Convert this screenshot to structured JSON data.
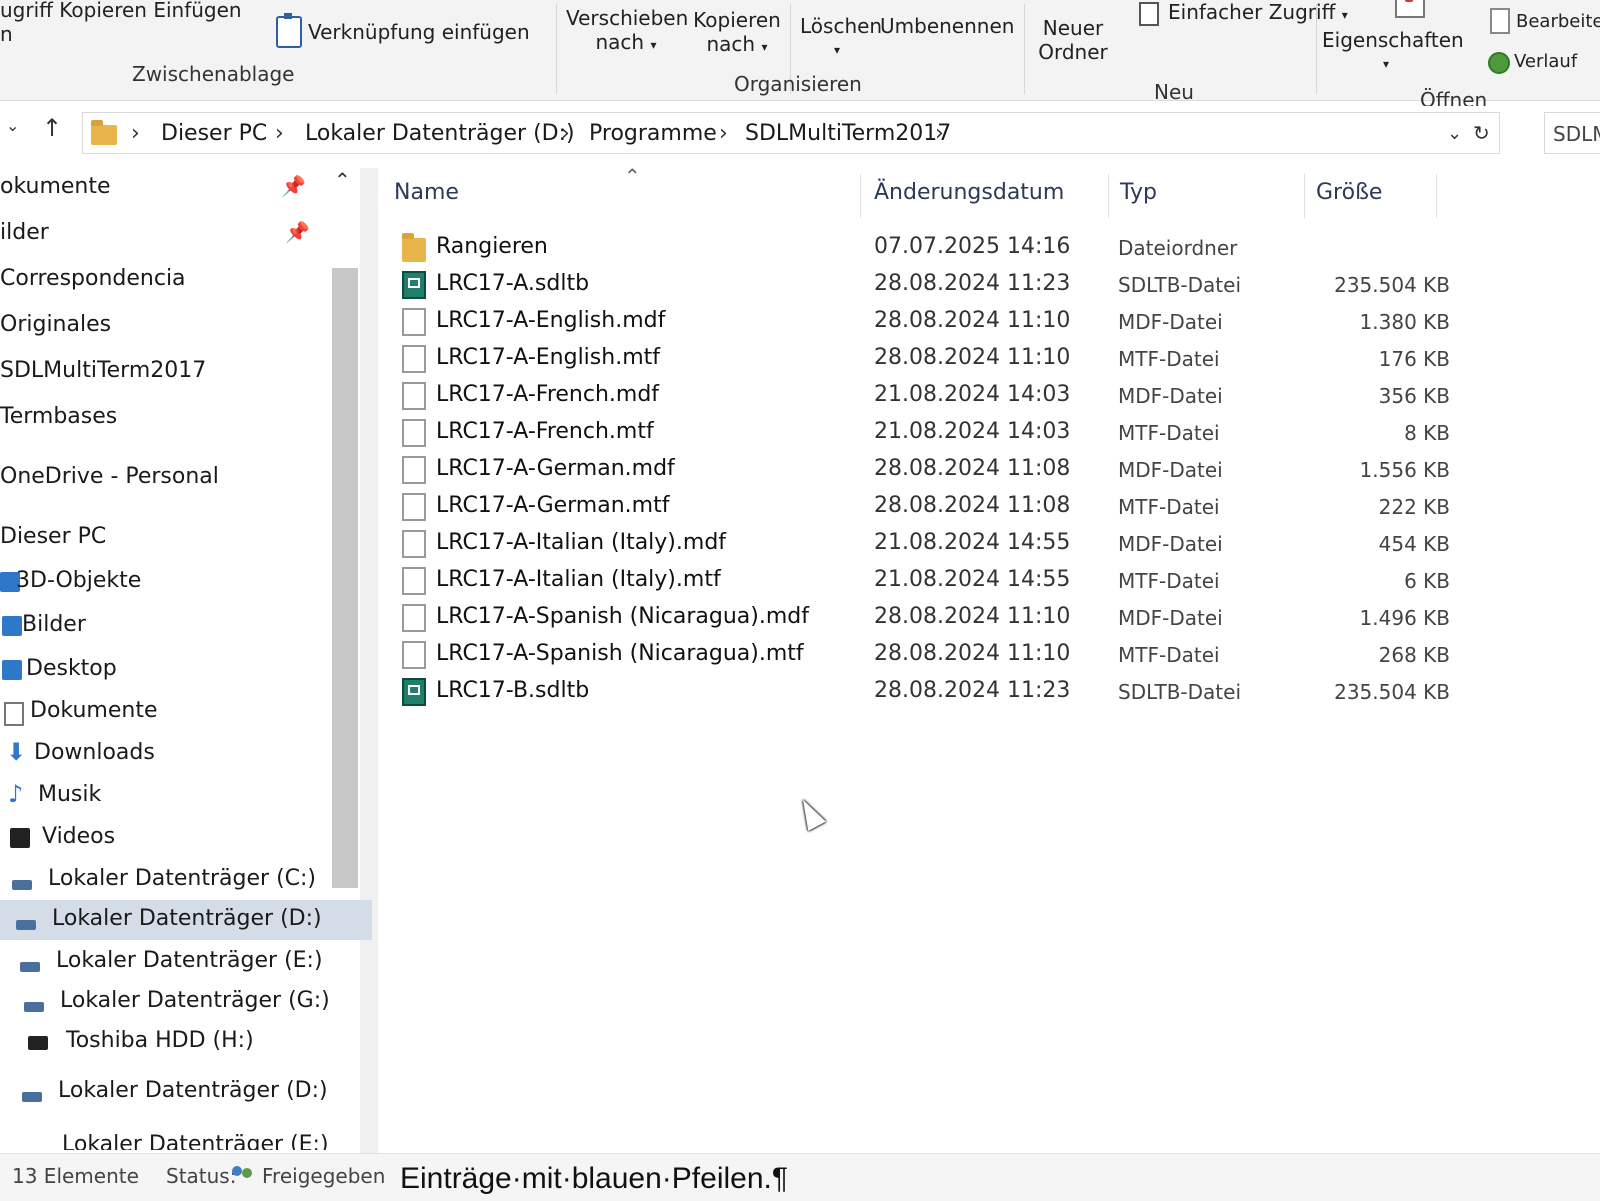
{
  "ribbon": {
    "clipboard_partial": "ugriff Kopieren Einfügen",
    "clipboard_partial2": "n",
    "paste_shortcut": "Verknüpfung einfügen",
    "clipboard_group": "Zwischenablage",
    "move_to_l1": "Verschieben",
    "move_to_l2": "nach",
    "copy_to_l1": "Kopieren",
    "copy_to_l2": "nach",
    "delete": "Löschen",
    "rename": "Umbenennen",
    "organize_group": "Organisieren",
    "new_folder_l1": "Neuer",
    "new_folder_l2": "Ordner",
    "easy_access": "Einfacher Zugriff",
    "new_group": "Neu",
    "properties": "Eigenschaften",
    "edit": "Bearbeiten",
    "history": "Verlauf",
    "open_group": "Öffnen"
  },
  "address": {
    "crumbs": [
      "Dieser PC",
      "Lokaler Datenträger (D:)",
      "Programme",
      "SDLMultiTerm2017"
    ],
    "search_placeholder": "SDLM"
  },
  "nav": {
    "items": [
      {
        "label": "okumente",
        "pinned": true
      },
      {
        "label": "ilder",
        "pinned": true
      },
      {
        "label": "Correspondencia"
      },
      {
        "label": "Originales"
      },
      {
        "label": "SDLMultiTerm2017"
      },
      {
        "label": "Termbases"
      },
      {
        "label": "OneDrive - Personal"
      },
      {
        "label": "Dieser PC"
      },
      {
        "label": "3D-Objekte"
      },
      {
        "label": "Bilder"
      },
      {
        "label": "Desktop"
      },
      {
        "label": "Dokumente"
      },
      {
        "label": "Downloads"
      },
      {
        "label": "Musik"
      },
      {
        "label": "Videos"
      },
      {
        "label": "Lokaler Datenträger (C:)"
      },
      {
        "label": "Lokaler Datenträger (D:)",
        "selected": true
      },
      {
        "label": "Lokaler Datenträger (E:)"
      },
      {
        "label": "Lokaler Datenträger (G:)"
      },
      {
        "label": "Toshiba HDD (H:)"
      },
      {
        "label": "Lokaler Datenträger (D:)"
      },
      {
        "label": "Lokaler Datenträger (E:)"
      }
    ]
  },
  "columns": {
    "name": "Name",
    "date": "Änderungsdatum",
    "type": "Typ",
    "size": "Größe"
  },
  "files": [
    {
      "name": "Rangieren",
      "date": "07.07.2025 14:16",
      "type": "Dateiordner",
      "size": "",
      "icon": "folder-icon"
    },
    {
      "name": "LRC17-A.sdltb",
      "date": "28.08.2024 11:23",
      "type": "SDLTB-Datei",
      "size": "235.504 KB",
      "icon": "sdltb-file-icon"
    },
    {
      "name": "LRC17-A-English.mdf",
      "date": "28.08.2024 11:10",
      "type": "MDF-Datei",
      "size": "1.380 KB",
      "icon": "document-icon"
    },
    {
      "name": "LRC17-A-English.mtf",
      "date": "28.08.2024 11:10",
      "type": "MTF-Datei",
      "size": "176 KB",
      "icon": "document-icon"
    },
    {
      "name": "LRC17-A-French.mdf",
      "date": "21.08.2024 14:03",
      "type": "MDF-Datei",
      "size": "356 KB",
      "icon": "document-icon"
    },
    {
      "name": "LRC17-A-French.mtf",
      "date": "21.08.2024 14:03",
      "type": "MTF-Datei",
      "size": "8 KB",
      "icon": "document-icon"
    },
    {
      "name": "LRC17-A-German.mdf",
      "date": "28.08.2024 11:08",
      "type": "MDF-Datei",
      "size": "1.556 KB",
      "icon": "document-icon"
    },
    {
      "name": "LRC17-A-German.mtf",
      "date": "28.08.2024 11:08",
      "type": "MTF-Datei",
      "size": "222 KB",
      "icon": "document-icon"
    },
    {
      "name": "LRC17-A-Italian (Italy).mdf",
      "date": "21.08.2024 14:55",
      "type": "MDF-Datei",
      "size": "454 KB",
      "icon": "document-icon"
    },
    {
      "name": "LRC17-A-Italian (Italy).mtf",
      "date": "21.08.2024 14:55",
      "type": "MTF-Datei",
      "size": "6 KB",
      "icon": "document-icon"
    },
    {
      "name": "LRC17-A-Spanish (Nicaragua).mdf",
      "date": "28.08.2024 11:10",
      "type": "MDF-Datei",
      "size": "1.496 KB",
      "icon": "document-icon"
    },
    {
      "name": "LRC17-A-Spanish (Nicaragua).mtf",
      "date": "28.08.2024 11:10",
      "type": "MTF-Datei",
      "size": "268 KB",
      "icon": "document-icon"
    },
    {
      "name": "LRC17-B.sdltb",
      "date": "28.08.2024 11:23",
      "type": "SDLTB-Datei",
      "size": "235.504 KB",
      "icon": "sdltb-file-icon"
    }
  ],
  "status": {
    "count": "13 Elemente",
    "label": "Status:",
    "shared": "Freigegeben"
  },
  "background_doc_text": "Einträge·mit·blauen·Pfeilen.¶"
}
